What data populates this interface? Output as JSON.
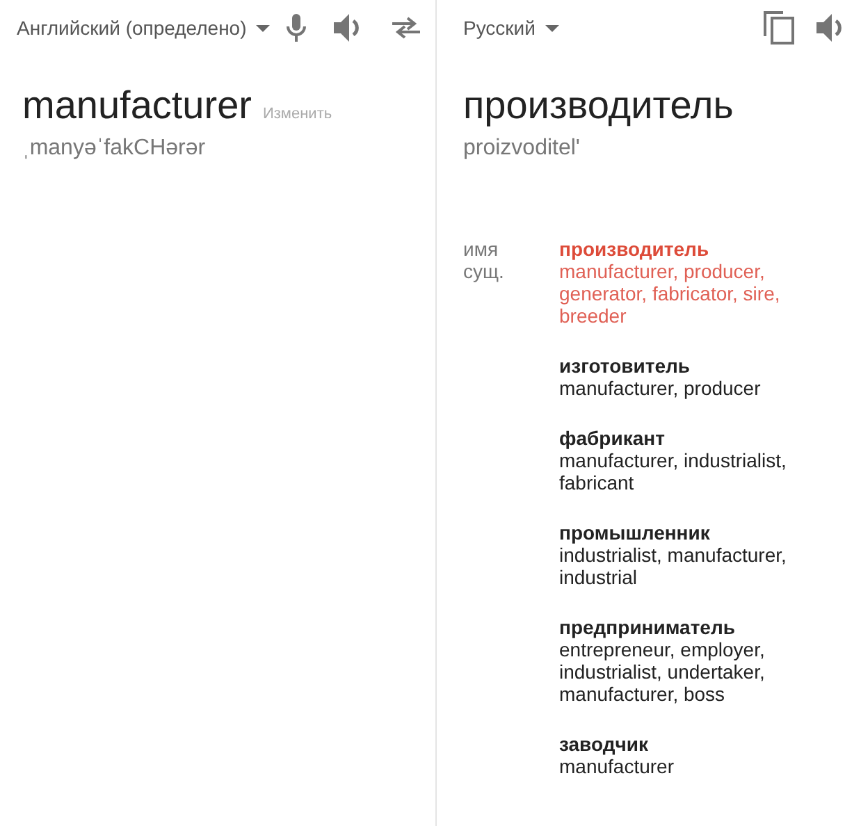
{
  "source": {
    "language": "Английский (определено)",
    "word": "manufacturer",
    "edit_link": "Изменить",
    "transcription": "ˌmanyəˈfakCHərər"
  },
  "target": {
    "language": "Русский",
    "word": "производитель",
    "transcription": "proizvoditel'"
  },
  "dictionary": {
    "part_of_speech": "имя сущ.",
    "entries": [
      {
        "word": "производитель",
        "translations": "manufacturer, producer, generator, fabricator, sire, breeder",
        "selected": true
      },
      {
        "word": "изготовитель",
        "translations": "manufacturer, producer",
        "selected": false
      },
      {
        "word": "фабрикант",
        "translations": "manufacturer, industrialist, fabricant",
        "selected": false
      },
      {
        "word": "промышленник",
        "translations": "industrialist, manufacturer, industrial",
        "selected": false
      },
      {
        "word": "предприниматель",
        "translations": "entrepreneur, employer, industrialist, undertaker, manufacturer, boss",
        "selected": false
      },
      {
        "word": "заводчик",
        "translations": "manufacturer",
        "selected": false
      }
    ]
  }
}
